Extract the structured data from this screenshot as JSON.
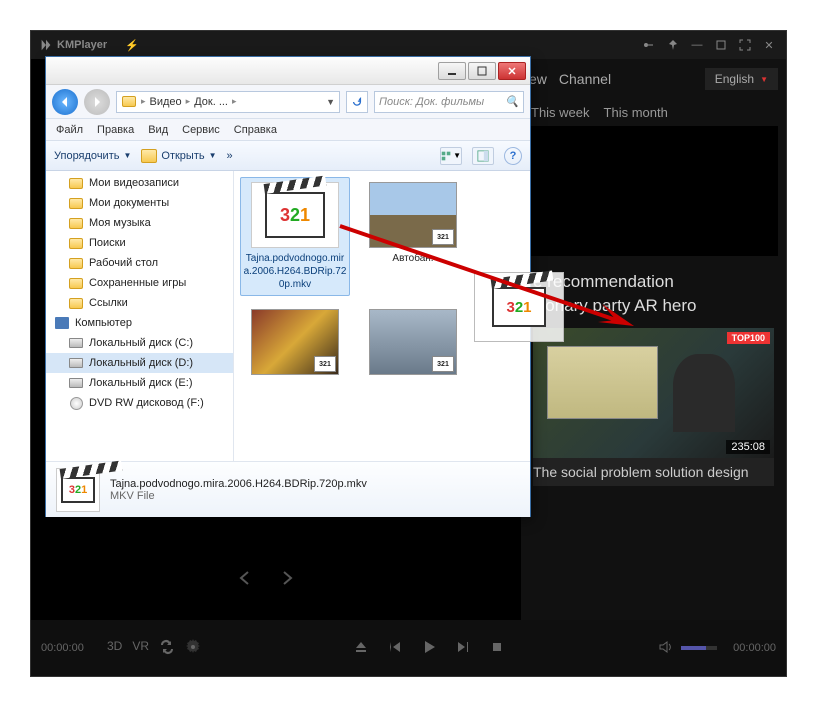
{
  "km": {
    "title": "KMPlayer",
    "tabs": {
      "view": "ew",
      "channel": "Channel"
    },
    "lang": "English",
    "sub_tabs": {
      "week": "This week",
      "month": "This month"
    },
    "reco_title_1": "e recommendation",
    "reco_title_2": "itionary party AR hero",
    "top_badge": "TOP100",
    "duration": "235:08",
    "card_title": "The social problem solution design",
    "time_left": "00:00:00",
    "time_right": "00:00:00",
    "btn_3d": "3D",
    "btn_vr": "VR"
  },
  "explorer": {
    "breadcrumb": {
      "seg1": "Видео",
      "seg2": "Док. ...",
      "folder_icon": "folder"
    },
    "search_placeholder": "Поиск: Док. фильмы",
    "menu": {
      "file": "Файл",
      "edit": "Правка",
      "view": "Вид",
      "service": "Сервис",
      "help": "Справка"
    },
    "toolbar": {
      "organize": "Упорядочить",
      "open": "Открыть",
      "more": "»"
    },
    "tree": [
      {
        "label": "Мои видеозаписи",
        "icon": "folder"
      },
      {
        "label": "Мои документы",
        "icon": "folder"
      },
      {
        "label": "Моя музыка",
        "icon": "folder"
      },
      {
        "label": "Поиски",
        "icon": "folder"
      },
      {
        "label": "Рабочий стол",
        "icon": "folder"
      },
      {
        "label": "Сохраненные игры",
        "icon": "folder"
      },
      {
        "label": "Ссылки",
        "icon": "folder"
      },
      {
        "label": "Компьютер",
        "icon": "pc",
        "root": true
      },
      {
        "label": "Локальный диск (C:)",
        "icon": "drive"
      },
      {
        "label": "Локальный диск (D:)",
        "icon": "drive",
        "selected": true
      },
      {
        "label": "Локальный диск (E:)",
        "icon": "drive"
      },
      {
        "label": "DVD RW дисковод (F:)",
        "icon": "dvd"
      }
    ],
    "files": {
      "selected": {
        "name": "Tajna.podvodnogo.mira.2006.H264.BDRip.720p.mkv",
        "badge": "321"
      },
      "item2": "Автобан.",
      "badge": "321"
    },
    "details": {
      "name": "Tajna.podvodnogo.mira.2006.H264.BDRip.720p.mkv",
      "type": "MKV File",
      "badge": "321"
    }
  }
}
